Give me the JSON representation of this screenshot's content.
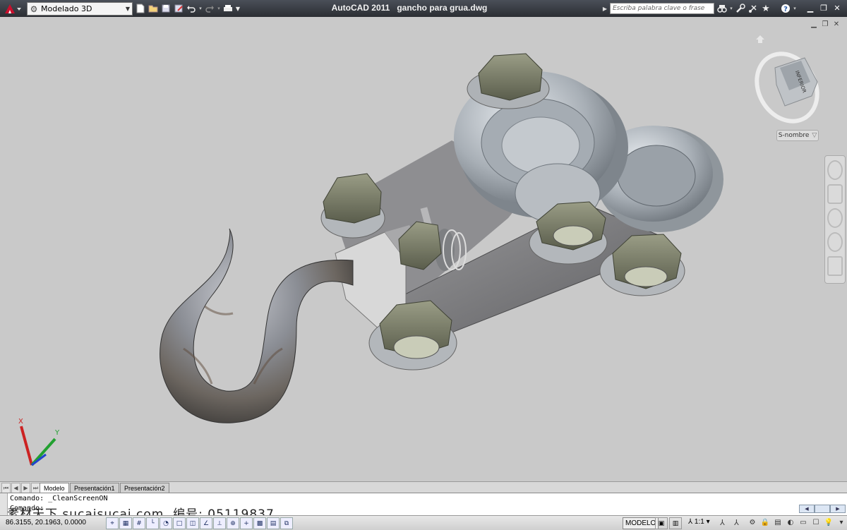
{
  "titlebar": {
    "app_name": "AutoCAD 2011",
    "file_name": "gancho para grua.dwg",
    "workspace": "Modelado 3D",
    "search_placeholder": "Escriba palabra clave o frase"
  },
  "viewcube": {
    "face_label": "INFERIOR",
    "wcs_label": "S-nombre"
  },
  "ucs": {
    "x_label": "X",
    "y_label": "Y"
  },
  "layout_tabs": [
    "Modelo",
    "Presentación1",
    "Presentación2"
  ],
  "command_line": {
    "line1": "Comando: _CleanScreenON",
    "line2": "Comando:"
  },
  "overlay_text": "素材天下 sucaisucai.com  编号: 05119837",
  "status": {
    "coordinates": "86.3155, 20.1963, 0.0000",
    "space_label": "MODELO",
    "annotation_scale": "1:1"
  },
  "colors": {
    "background": "#c9c9c9",
    "titlebar": "#2f3238",
    "accent_red": "#c8102e"
  }
}
